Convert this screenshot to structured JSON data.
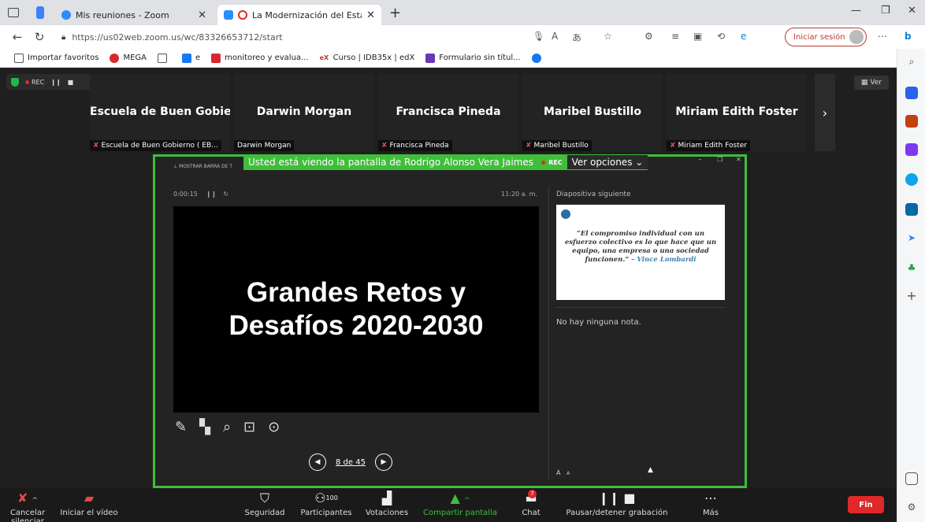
{
  "browser": {
    "tabs": [
      {
        "title": "Mis reuniones - Zoom"
      },
      {
        "title": "La Modernización del Estad"
      }
    ],
    "url": "https://us02web.zoom.us/wc/83326653712/start",
    "signin": "Iniciar sesión",
    "bookmarks": [
      "Importar favoritos",
      "MEGA",
      "e",
      "monitoreo y evalua...",
      "Curso | IDB35x | edX",
      "Formulario sin títul..."
    ]
  },
  "meeting": {
    "rec": "REC",
    "ver": "Ver",
    "participants": [
      {
        "tile": "Escuela de Buen Gobie...",
        "label": "Escuela de Buen Gobierno ( EB..."
      },
      {
        "tile": "Darwin Morgan",
        "label": "Darwin Morgan"
      },
      {
        "tile": "Francisca Pineda",
        "label": "Francisca Pineda"
      },
      {
        "tile": "Maribel Bustillo",
        "label": "Maribel Bustillo"
      },
      {
        "tile": "Miriam Edith Foster",
        "label": "Miriam Edith Foster"
      }
    ]
  },
  "share": {
    "banner": "Usted está viendo la pantalla de Rodrigo Alonso Vera Jaimes",
    "banner_rec": "REC",
    "view_options": "Ver opciones",
    "show_bar": "MOSTRAR BARRA DE T",
    "timer": "0:00:15",
    "clock": "11:20 a. m.",
    "slide_line1": "Grandes Retos y",
    "slide_line2": "Desafíos 2020-2030",
    "next_title": "Diapositiva siguiente",
    "next_quote": "“El compromiso individual con un esfuerzo colectivo es lo que hace que un equipo, una empresa o una sociedad funcionen.”",
    "next_author": "– Vince Lombardi",
    "notes": "No hay ninguna nota.",
    "page": "8 de 45"
  },
  "toolbar": {
    "mute": "Cancelar silenciar",
    "video": "Iniciar el vídeo",
    "security": "Seguridad",
    "participants": "Participantes",
    "participants_count": "100",
    "polls": "Votaciones",
    "share": "Compartir pantalla",
    "chat": "Chat",
    "chat_badge": "7",
    "record": "Pausar/detener grabación",
    "more": "Más",
    "end": "Fin"
  }
}
